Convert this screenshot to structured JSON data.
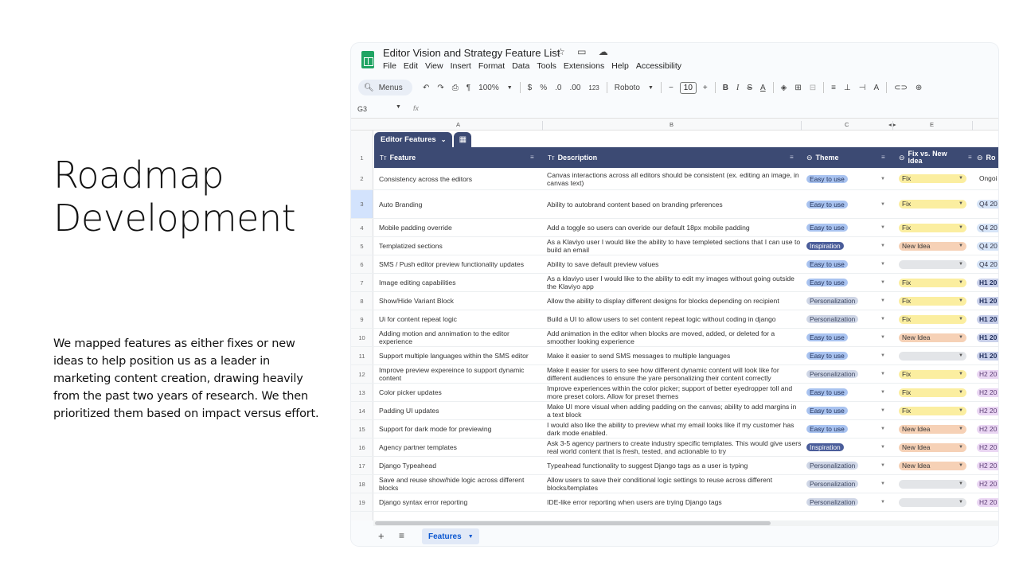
{
  "slide": {
    "title_line1": "Roadmap",
    "title_line2": "Development",
    "body": "We mapped features as either fixes or new ideas to help position us as a leader in marketing content creation, drawing heavily from the past two years of research. We then prioritized them based on impact versus effort."
  },
  "app": {
    "doc_title": "Editor Vision and Strategy Feature List",
    "title_icons": "☆ ▭ ☁",
    "menus": [
      "File",
      "Edit",
      "View",
      "Insert",
      "Format",
      "Data",
      "Tools",
      "Extensions",
      "Help",
      "Accessibility"
    ],
    "toolbar": {
      "search_label": "Menus",
      "zoom": "100%",
      "currency": "$",
      "percent": "%",
      "dec_less": ".0",
      "dec_more": ".00",
      "num_format": "123",
      "font": "Roboto",
      "font_size": "10"
    },
    "name_box": "G3",
    "fx": "fx",
    "columns": [
      "A",
      "B",
      "C",
      "E"
    ],
    "table_tab": "Editor Features",
    "headers": {
      "feature": "Feature",
      "description": "Description",
      "theme": "Theme",
      "fix": "Fix vs. New Idea",
      "roadmap": "Ro"
    },
    "sheet_tab": "Features"
  },
  "colors": {
    "header_bg": "#3c4a73",
    "chip_easy": "#a9c3f0",
    "chip_inspiration": "#4a5d9a",
    "chip_personalization": "#cfd6e6",
    "fix_bg": "#fbeea0",
    "newidea_bg": "#f6d1b6",
    "empty_bg": "#e3e5e8"
  },
  "rows": [
    {
      "n": "1"
    },
    {
      "n": "2",
      "feature": "Consistency across the editors",
      "desc": "Canvas interactions across all editors should be consistent (ex. editing an image, in canvas text)",
      "theme": "Easy to use",
      "fix": "Fix",
      "road": "Ongoi"
    },
    {
      "n": "3",
      "feature": "Auto Branding",
      "desc": "Ability to autobrand content based on branding prferences",
      "theme": "Easy to use",
      "fix": "Fix",
      "road": "Q4 20"
    },
    {
      "n": "4",
      "feature": "Mobile padding override",
      "desc": "Add a toggle so users can overide our default 18px mobile padding",
      "theme": "Easy to use",
      "fix": "Fix",
      "road": "Q4 20"
    },
    {
      "n": "5",
      "feature": "Templatized sections",
      "desc": "As a Klaviyo user I would like the ability to have templeted sections that I can use to build an email",
      "theme": "Inspiration",
      "fix": "New Idea",
      "road": "Q4 20"
    },
    {
      "n": "6",
      "feature": "SMS / Push editor preview functionality updates",
      "desc": "Ability to save default preview values",
      "theme": "Easy to use",
      "fix": "",
      "road": "Q4 20"
    },
    {
      "n": "7",
      "feature": "Image editing capabilities",
      "desc": "As a klaviyo user I would like to the ability to edit my images without going outside the Klaviyo app",
      "theme": "Easy to use",
      "fix": "Fix",
      "road": "H1 20"
    },
    {
      "n": "8",
      "feature": "Show/Hide Variant Block",
      "desc": "Allow the ability to display different designs for blocks depending on recipient",
      "theme": "Personalization",
      "fix": "Fix",
      "road": "H1 20"
    },
    {
      "n": "9",
      "feature": "Ui for content repeat logic",
      "desc": "Build a UI to allow users to set content repeat logic without coding in django",
      "theme": "Personalization",
      "fix": "Fix",
      "road": "H1 20"
    },
    {
      "n": "10",
      "feature": "Adding motion and annimation to the editor experience",
      "desc": "Add animation in the editor when blocks are moved, added, or deleted for a smoother looking experience",
      "theme": "Easy to use",
      "fix": "New Idea",
      "road": "H1 20"
    },
    {
      "n": "11",
      "feature": "Support multiple languages within the SMS editor",
      "desc": "Make it easier to send SMS messages to multiple languages",
      "theme": "Easy to use",
      "fix": "",
      "road": "H1 20"
    },
    {
      "n": "12",
      "feature": "Improve preview expereince to support dynamic content",
      "desc": "Make it easier for users to see how different dynamic content will look like for different audiences to ensure the yare personalizing their content correctly",
      "theme": "Personalization",
      "fix": "Fix",
      "road": "H2 20"
    },
    {
      "n": "13",
      "feature": "Color picker updates",
      "desc": "Improve experiences within the color picker; support of better eyedropper toll and more preset colors. Allow for preset themes",
      "theme": "Easy to use",
      "fix": "Fix",
      "road": "H2 20"
    },
    {
      "n": "14",
      "feature": "Padding UI updates",
      "desc": "Make UI more visual when adding padding on the canvas; ability to add margins in a text block",
      "theme": "Easy to use",
      "fix": "Fix",
      "road": "H2 20"
    },
    {
      "n": "15",
      "feature": "Support for dark mode for previewing",
      "desc": "I would also like the ability to preview what my email looks like if my customer has dark mode enabled.",
      "theme": "Easy to use",
      "fix": "New Idea",
      "road": "H2 20"
    },
    {
      "n": "16",
      "feature": "Agency partner templates",
      "desc": "Ask 3-5 agency partners to create industry specific templates. This would give users real world content that is fresh, tested, and actionable to try",
      "theme": "Inspiration",
      "fix": "New Idea",
      "road": "H2 20"
    },
    {
      "n": "17",
      "feature": "Django Typeahead",
      "desc": "Typeahead functionality to suggest Django tags as a user is typing",
      "theme": "Personalization",
      "fix": "New Idea",
      "road": "H2 20"
    },
    {
      "n": "18",
      "feature": "Save and reuse show/hide logic across different blocks",
      "desc": "Allow users to save their conditional logic settings to reuse across different blocks/templates",
      "theme": "Personalization",
      "fix": "",
      "road": "H2 20"
    },
    {
      "n": "19",
      "feature": "Django syntax error reporting",
      "desc": "IDE-like error reporting when users are trying Django tags",
      "theme": "Personalization",
      "fix": "",
      "road": "H2 20"
    }
  ]
}
